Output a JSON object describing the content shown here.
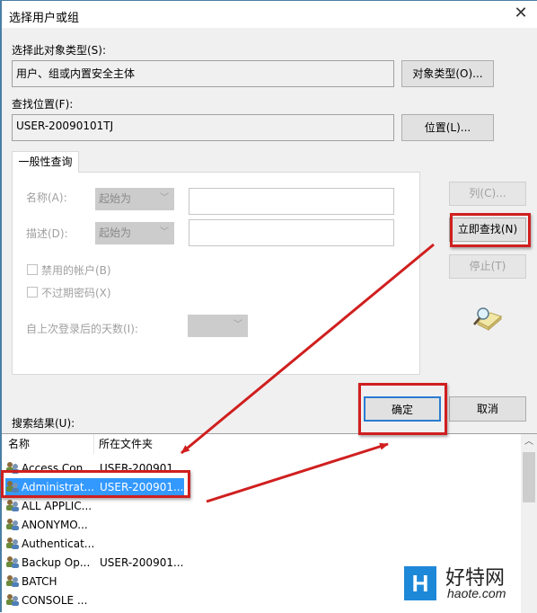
{
  "window": {
    "title": "选择用户或组",
    "close_glyph": "✕"
  },
  "object_type": {
    "label": "选择此对象类型(S):",
    "value": "用户、组或内置安全主体",
    "button": "对象类型(O)..."
  },
  "location": {
    "label": "查找位置(F):",
    "value": "USER-20090101TJ",
    "button": "位置(L)..."
  },
  "query": {
    "tab_label": "一般性查询",
    "name_label": "名称(A):",
    "name_mode": "起始为",
    "name_value": "",
    "desc_label": "描述(D):",
    "desc_mode": "起始为",
    "desc_value": "",
    "disabled_accounts_label": "禁用的帐户(B)",
    "disabled_accounts_checked": false,
    "non_expiring_pw_label": "不过期密码(X)",
    "non_expiring_pw_checked": false,
    "days_since_login_label": "自上次登录后的天数(I):",
    "days_since_login_value": ""
  },
  "side_buttons": {
    "columns": "列(C)...",
    "find_now": "立即查找(N)",
    "stop": "停止(T)"
  },
  "dialog_buttons": {
    "ok": "确定",
    "cancel": "取消"
  },
  "results": {
    "label": "搜索结果(U):",
    "columns": [
      "名称",
      "所在文件夹"
    ],
    "rows": [
      {
        "name": "Access Con...",
        "folder": "USER-200901...",
        "selected": false
      },
      {
        "name": "Administrat...",
        "folder": "USER-200901...",
        "selected": true
      },
      {
        "name": "ALL APPLIC...",
        "folder": "",
        "selected": false
      },
      {
        "name": "ANONYMO...",
        "folder": "",
        "selected": false
      },
      {
        "name": "Authenticat...",
        "folder": "",
        "selected": false
      },
      {
        "name": "Backup Op...",
        "folder": "USER-200901...",
        "selected": false
      },
      {
        "name": "BATCH",
        "folder": "",
        "selected": false
      },
      {
        "name": "CONSOLE ...",
        "folder": "",
        "selected": false
      }
    ]
  },
  "watermark": {
    "logo_letter": "H",
    "cn": "好特网",
    "en": "haote.com"
  },
  "colors": {
    "annotation_red": "#d01f1f",
    "selection_blue": "#3399ff",
    "default_button_border": "#2a7bd0"
  }
}
